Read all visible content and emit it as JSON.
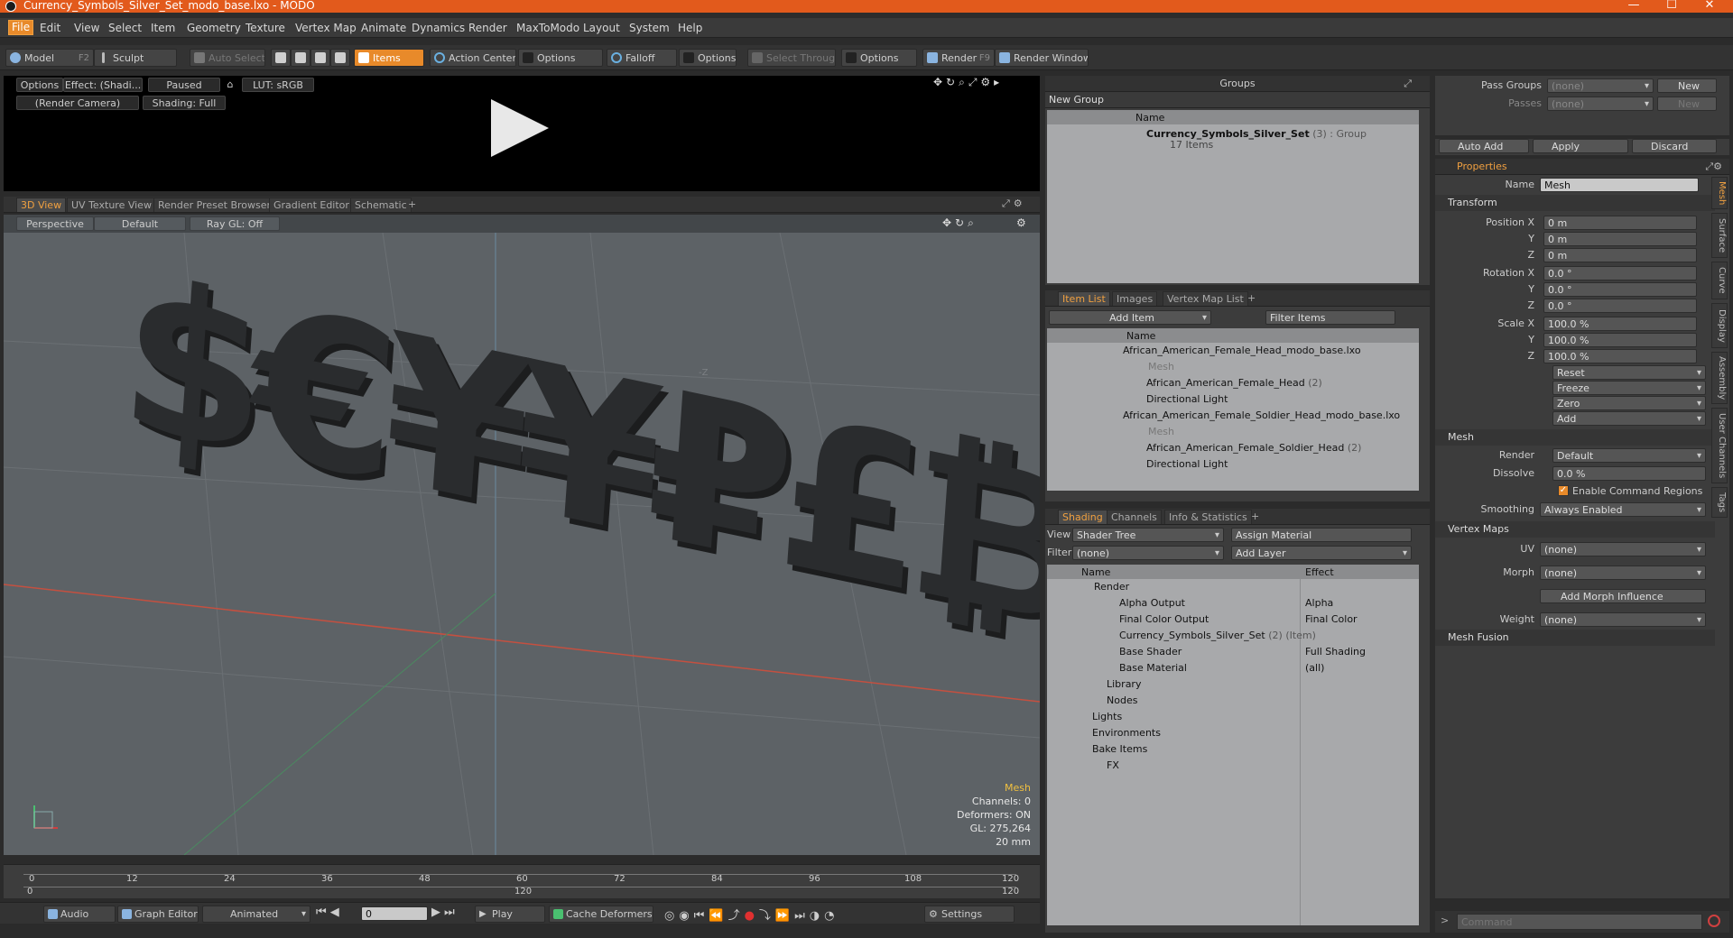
{
  "window": {
    "title": "Currency_Symbols_Silver_Set_modo_base.lxo - MODO",
    "minimize": "—",
    "maximize": "☐",
    "close": "✕"
  },
  "menu": [
    "File",
    "Edit",
    "View",
    "Select",
    "Item",
    "Geometry",
    "Texture",
    "Vertex Map",
    "Animate",
    "Dynamics",
    "Render",
    "MaxToModo",
    "Layout",
    "System",
    "Help"
  ],
  "toolbar": {
    "model": "Model",
    "model_key": "F2",
    "sculpt": "Sculpt",
    "auto_select": "Auto Select",
    "items": "Items",
    "action_center": "Action Center",
    "options1": "Options",
    "falloff": "Falloff",
    "options2": "Options",
    "select_through": "Select Through",
    "options3": "Options",
    "render": "Render",
    "render_key": "F9",
    "render_window": "Render Window"
  },
  "preview": {
    "options": "Options",
    "effect": "Effect: (Shadi...",
    "paused": "Paused",
    "lut": "LUT: sRGB",
    "camera": "(Render Camera)",
    "shading": "Shading: Full"
  },
  "viewport_tabs": [
    "3D View",
    "UV Texture View",
    "Render Preset Browser",
    "Gradient Editor",
    "Schematic",
    "+"
  ],
  "viewport": {
    "perspective": "Perspective",
    "default": "Default",
    "raygl": "Ray GL: Off",
    "z_marker": "-Z",
    "info": {
      "selected": "Mesh",
      "channels": "Channels: 0",
      "deformers": "Deformers: ON",
      "gl": "GL: 275,264",
      "scale": "20 mm"
    },
    "symbols": "$€¥¥₽£₿"
  },
  "timeline": {
    "top_ticks": [
      "0",
      "12",
      "24",
      "36",
      "48",
      "60",
      "72",
      "84",
      "96",
      "108",
      "120"
    ],
    "bottom_ticks": [
      "0",
      "120",
      "120"
    ]
  },
  "bottom_bar": {
    "audio": "Audio",
    "graph_editor": "Graph Editor",
    "animated": "Animated",
    "frame": "0",
    "play": "Play",
    "cache_deformers": "Cache Deformers",
    "settings": "Settings"
  },
  "groups": {
    "title": "Groups",
    "new_group": "New Group",
    "col_name": "Name",
    "row_name": "Currency_Symbols_Silver_Set",
    "row_count": "(3)",
    "row_type": ": Group",
    "row_items": "17 Items"
  },
  "item_list": {
    "tabs": [
      "Item List",
      "Images",
      "Vertex Map List",
      "+"
    ],
    "add_item": "Add Item",
    "filter": "Filter Items",
    "col_name": "Name",
    "rows": [
      {
        "label": "African_American_Female_Head_modo_base.lxo",
        "extra": ""
      },
      {
        "label": "Mesh",
        "extra": ""
      },
      {
        "label": "African_American_Female_Head",
        "extra": "(2)"
      },
      {
        "label": "Directional Light",
        "extra": ""
      },
      {
        "label": "African_American_Female_Soldier_Head_modo_base.lxo",
        "extra": ""
      },
      {
        "label": "Mesh",
        "extra": ""
      },
      {
        "label": "African_American_Female_Soldier_Head",
        "extra": "(2)"
      },
      {
        "label": "Directional Light",
        "extra": ""
      }
    ]
  },
  "shading": {
    "tabs": [
      "Shading",
      "Channels",
      "Info & Statistics",
      "+"
    ],
    "view_label": "View",
    "view_value": "Shader Tree",
    "assign_material": "Assign Material",
    "filter_label": "Filter",
    "filter_value": "(none)",
    "add_layer": "Add Layer",
    "col_name": "Name",
    "col_effect": "Effect",
    "rows": [
      {
        "name": "Render",
        "extra": "",
        "effect": ""
      },
      {
        "name": "Alpha Output",
        "extra": "",
        "effect": "Alpha"
      },
      {
        "name": "Final Color Output",
        "extra": "",
        "effect": "Final Color"
      },
      {
        "name": "Currency_Symbols_Silver_Set",
        "extra": "(2) (Item)",
        "effect": ""
      },
      {
        "name": "Base Shader",
        "extra": "",
        "effect": "Full Shading"
      },
      {
        "name": "Base Material",
        "extra": "",
        "effect": "(all)"
      },
      {
        "name": "Library",
        "extra": "",
        "effect": ""
      },
      {
        "name": "Nodes",
        "extra": "",
        "effect": ""
      },
      {
        "name": "Lights",
        "extra": "",
        "effect": ""
      },
      {
        "name": "Environments",
        "extra": "",
        "effect": ""
      },
      {
        "name": "Bake Items",
        "extra": "",
        "effect": ""
      },
      {
        "name": "FX",
        "extra": "",
        "effect": ""
      }
    ]
  },
  "pass": {
    "pass_groups": "Pass Groups",
    "pass_groups_value": "(none)",
    "new": "New",
    "passes": "Passes",
    "passes_value": "(none)",
    "new2": "New",
    "auto_add": "Auto Add",
    "apply": "Apply",
    "discard": "Discard"
  },
  "properties": {
    "tab": "Properties",
    "name_label": "Name",
    "name_value": "Mesh",
    "transform": "Transform",
    "position_x": "Position X",
    "y": "Y",
    "z": "Z",
    "pos": [
      "0 m",
      "0 m",
      "0 m"
    ],
    "rotation_x": "Rotation X",
    "rot": [
      "0.0 °",
      "0.0 °",
      "0.0 °"
    ],
    "scale_x": "Scale X",
    "scl": [
      "100.0 %",
      "100.0 %",
      "100.0 %"
    ],
    "reset": "Reset",
    "freeze": "Freeze",
    "zero": "Zero",
    "add": "Add",
    "mesh": "Mesh",
    "render_label": "Render",
    "render_value": "Default",
    "dissolve_label": "Dissolve",
    "dissolve_value": "0.0 %",
    "enable_cmd": "Enable Command Regions",
    "smoothing_label": "Smoothing",
    "smoothing_value": "Always Enabled",
    "vertex_maps": "Vertex Maps",
    "uv_label": "UV",
    "uv_value": "(none)",
    "morph_label": "Morph",
    "morph_value": "(none)",
    "add_morph": "Add Morph Influence",
    "weight_label": "Weight",
    "weight_value": "(none)",
    "mesh_fusion": "Mesh Fusion",
    "side_tabs": [
      "Mesh",
      "Surface",
      "Curve",
      "Display",
      "Assembly",
      "User Channels",
      "Tags"
    ]
  },
  "command": {
    "placeholder": "Command"
  },
  "colors": {
    "accent": "#e88a2a",
    "titlebar": "#e25a1c"
  }
}
